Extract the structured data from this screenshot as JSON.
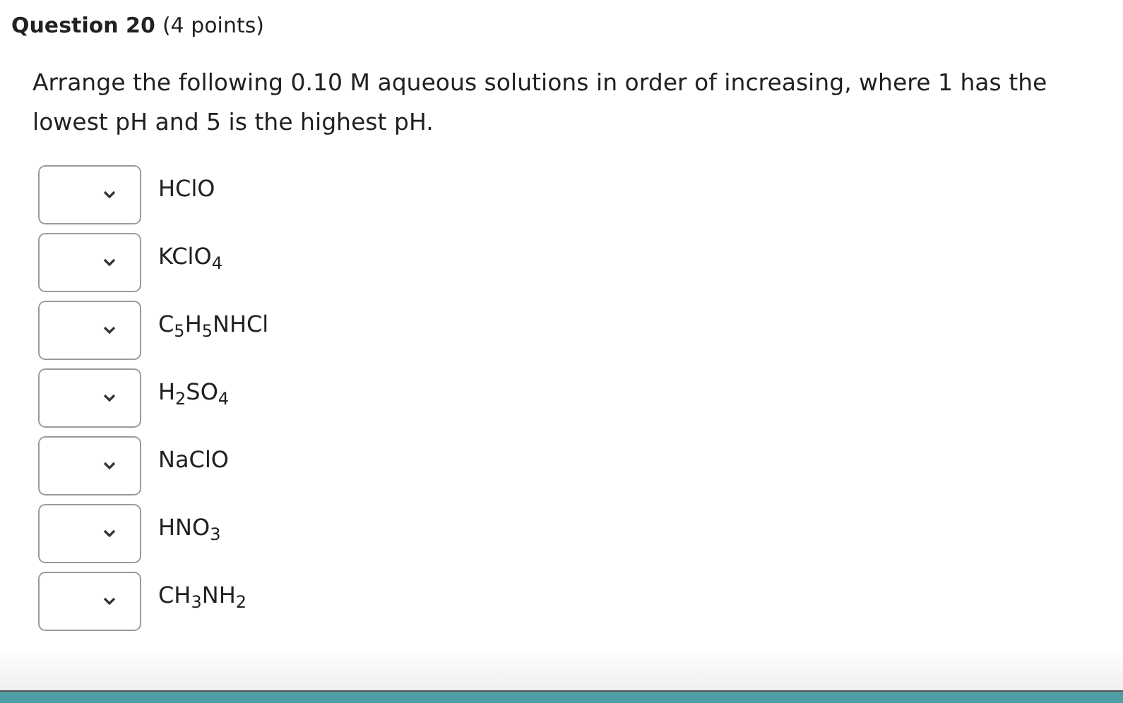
{
  "question": {
    "title": "Question 20",
    "points": "(4 points)"
  },
  "prompt": "Arrange the following 0.10 M aqueous solutions in order of increasing, where 1 has the lowest pH and 5 is the highest pH.",
  "items": [
    {
      "label": "HClO"
    },
    {
      "label": "KClO$_{4}$"
    },
    {
      "label": "C$_{5}$H$_{5}$NHCl"
    },
    {
      "label": "H$_{2}$SO$_{4}$"
    },
    {
      "label": "NaClO"
    },
    {
      "label": "HNO$_{3}$"
    },
    {
      "label": "CH$_{3}$NH$_{2}$"
    }
  ]
}
